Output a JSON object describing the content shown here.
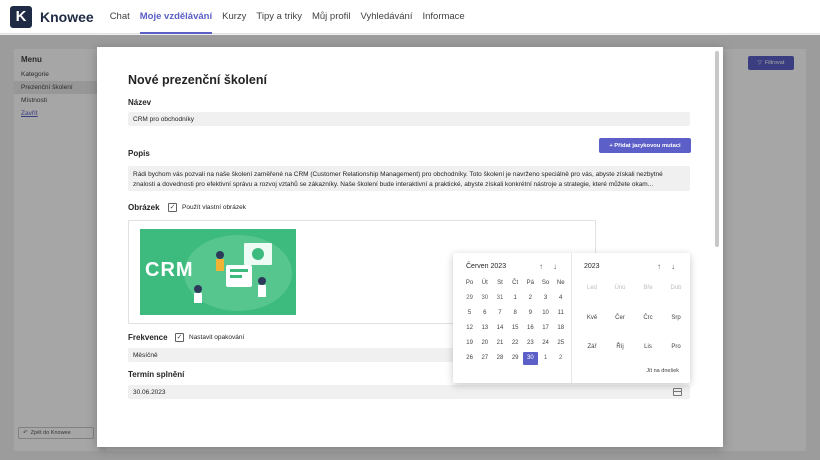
{
  "topbar": {
    "logo_letter": "K",
    "app_name": "Knowee",
    "tabs": [
      {
        "label": "Chat"
      },
      {
        "label": "Moje vzdělávání",
        "active": true
      },
      {
        "label": "Kurzy"
      },
      {
        "label": "Tipy a triky"
      },
      {
        "label": "Můj profil"
      },
      {
        "label": "Vyhledávání"
      },
      {
        "label": "Informace"
      }
    ]
  },
  "sidebar": {
    "title": "Menu",
    "items": [
      {
        "label": "Kategorie"
      },
      {
        "label": "Prezenční školení",
        "active": true
      },
      {
        "label": "Místnosti"
      },
      {
        "label": "Zavřít",
        "link": true
      }
    ],
    "back_label": "Zpět do Knowee"
  },
  "toolbar": {
    "filter_label": "Filtrovat"
  },
  "modal": {
    "title": "Nové prezenční školení",
    "name_label": "Název",
    "name_value": "CRM pro obchodníky",
    "add_language_button": "+ Přidat jazykovou mutaci",
    "description_label": "Popis",
    "description_value": "Rádi bychom vás pozvali na naše školení zaměřené na CRM (Customer Relationship Management) pro obchodníky. Toto školení je navrženo speciálně pro vás, abyste získali nezbytné znalosti a dovednosti pro efektivní správu a rozvoj vztahů se zákazníky. Naše školení bude interaktivní a praktické, abyste získali konkrétní nástroje a strategie, které můžete okam...",
    "image_label": "Obrázek",
    "image_checkbox_label": "Použít vlastní obrázek",
    "image_text": "CRM",
    "frequency_label": "Frekvence",
    "frequency_checkbox_label": "Nastavit opakování",
    "frequency_value": "Měsíčně",
    "deadline_label": "Termín splnění",
    "deadline_value": "30.06.2023"
  },
  "datepicker": {
    "month_header": "Červen 2023",
    "year_header": "2023",
    "weekdays": [
      "Po",
      "Út",
      "St",
      "Čt",
      "Pá",
      "So",
      "Ne"
    ],
    "weeks": [
      [
        "29",
        "30",
        "31",
        "1",
        "2",
        "3",
        "4"
      ],
      [
        "5",
        "6",
        "7",
        "8",
        "9",
        "10",
        "11"
      ],
      [
        "12",
        "13",
        "14",
        "15",
        "16",
        "17",
        "18"
      ],
      [
        "19",
        "20",
        "21",
        "22",
        "23",
        "24",
        "25"
      ],
      [
        "26",
        "27",
        "28",
        "29",
        "30",
        "1",
        "2"
      ]
    ],
    "selected_day": "30",
    "months": [
      "Led",
      "Úno",
      "Bře",
      "Dub",
      "Kvě",
      "Čer",
      "Črc",
      "Srp",
      "Zář",
      "Říj",
      "Lis",
      "Pro"
    ],
    "today_link": "Jít na dnešek"
  },
  "colors": {
    "accent": "#5b5fc7",
    "logo_bg": "#1f2a44",
    "image_bg": "#3dba7e"
  }
}
